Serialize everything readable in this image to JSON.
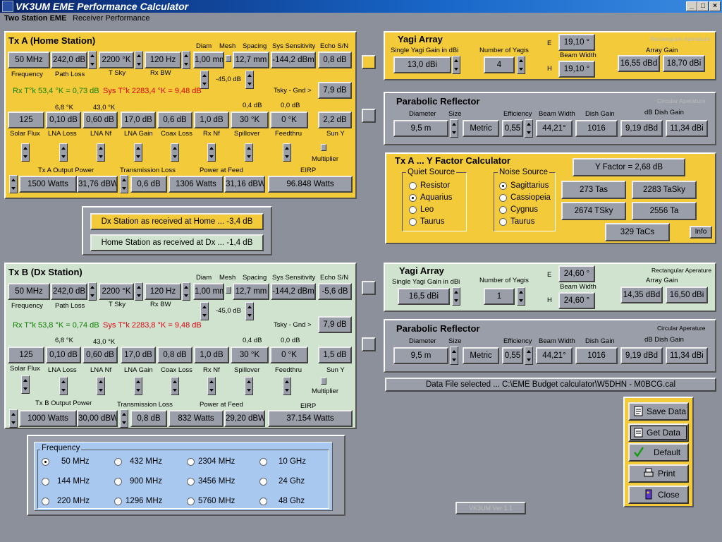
{
  "window": {
    "title": "VK3UM EME Performance Calculator"
  },
  "menu": [
    "Two Station EME",
    "Receiver Performance"
  ],
  "tx_a": {
    "title": "Tx A (Home Station)",
    "hdr": {
      "diam": "Diam",
      "mesh": "Mesh",
      "spacing": "Spacing",
      "sys_sens": "Sys Sensitivity",
      "echo": "Echo S/N"
    },
    "r1": {
      "freq": "50 MHz",
      "path": "242,0 dB",
      "tsky": "2200 °K",
      "rxbw": "120 Hz",
      "diam": "1,00 mm",
      "spacing": "12,7 mm",
      "sens": "-144,2 dBm",
      "echo": "0,8 dB"
    },
    "r1_labels": {
      "freq": "Frequency",
      "path": "Path Loss",
      "tsky": "T Sky",
      "rxbw": "Rx BW",
      "mesh_db": "-45,0 dB"
    },
    "rx_tk": "Rx T°k 53,4 °K = 0,73 dB",
    "sys_tk": "Sys T°k 2283,4 °K = 9,48 dB",
    "tsky_gnd_label": "Tsky - Gnd >",
    "tsky_gnd": "7,9 dB",
    "r2_top": {
      "lna_k": "6,8 °K",
      "lnanf_k": "43,0 °K",
      "spill_db": "0,4 dB",
      "feed_db": "0,0 dB"
    },
    "r2": {
      "solar": "125",
      "lna_loss": "0,10 dB",
      "lna_nf": "0,60 dB",
      "lna_gain": "17,0 dB",
      "coax": "0,6 dB",
      "rxnf": "1,0 dB",
      "spill": "30 °K",
      "feed": "0 °K",
      "suny": "2,2 dB"
    },
    "r2_labels": {
      "solar": "Solar Flux",
      "lna_loss": "LNA Loss",
      "lna_nf": "LNA Nf",
      "lna_gain": "LNA Gain",
      "coax": "Coax Loss",
      "rxnf": "Rx Nf",
      "spill": "Spillover",
      "feed": "Feedthru",
      "suny": "Sun Y",
      "mult": "Multiplier"
    },
    "r3_labels": {
      "out": "Tx A Output Power",
      "tl": "Transmission Loss",
      "paf": "Power at Feed",
      "eirp": "EIRP"
    },
    "r3": {
      "watts": "1500 Watts",
      "dbw": "31,76 dBW",
      "tl": "0,6 dB",
      "paf_w": "1306 Watts",
      "paf_dbw": "31,16 dBW",
      "eirp": "96.848 Watts"
    }
  },
  "received": {
    "dx_home": "Dx Station as received at Home ... -3,4 dB",
    "home_dx": "Home Station as received at Dx ... -1,4 dB"
  },
  "tx_b": {
    "title": "Tx B (Dx Station)",
    "hdr": {
      "diam": "Diam",
      "mesh": "Mesh",
      "spacing": "Spacing",
      "sys_sens": "Sys Sensitivity",
      "echo": "Echo S/N"
    },
    "r1": {
      "freq": "50 MHz",
      "path": "242,0 dB",
      "tsky": "2200 °K",
      "rxbw": "120 Hz",
      "diam": "1,00 mm",
      "spacing": "12,7 mm",
      "sens": "-144,2 dBm",
      "echo": "-5,6 dB"
    },
    "r1_labels": {
      "freq": "Frequency",
      "path": "Path Loss",
      "tsky": "T Sky",
      "rxbw": "Rx BW",
      "mesh_db": "-45,0 dB"
    },
    "rx_tk": "Rx T°k 53,8 °K = 0,74 dB",
    "sys_tk": "Sys T°k 2283,8 °K = 9,48 dB",
    "tsky_gnd_label": "Tsky - Gnd >",
    "tsky_gnd": "7,9 dB",
    "r2_top": {
      "lna_k": "6,8 °K",
      "lnanf_k": "43,0 °K",
      "spill_db": "0,4 dB",
      "feed_db": "0,0 dB"
    },
    "r2": {
      "solar": "125",
      "lna_loss": "0,10 dB",
      "lna_nf": "0,60 dB",
      "lna_gain": "17,0 dB",
      "coax": "0,8 dB",
      "rxnf": "1,0 dB",
      "spill": "30 °K",
      "feed": "0 °K",
      "suny": "1,5 dB"
    },
    "r2_labels": {
      "solar": "Solar Flux",
      "lna_loss": "LNA Loss",
      "lna_nf": "LNA Nf",
      "lna_gain": "LNA Gain",
      "coax": "Coax Loss",
      "rxnf": "Rx Nf",
      "spill": "Spillover",
      "feed": "Feedthru",
      "suny": "Sun Y",
      "mult": "Multiplier"
    },
    "r3_labels": {
      "out": "Tx B Output Power",
      "tl": "Transmission Loss",
      "paf": "Power at Feed",
      "eirp": "EIRP"
    },
    "r3": {
      "watts": "1000 Watts",
      "dbw": "30,00 dBW",
      "tl": "0,8 dB",
      "paf_w": "832 Watts",
      "paf_dbw": "29,20 dBW",
      "eirp": "37.154 Watts"
    }
  },
  "frequency": {
    "title": "Frequency",
    "options": [
      "50 MHz",
      "144 MHz",
      "220 MHz",
      "432 MHz",
      "900 MHz",
      "1296 MHz",
      "2304 MHz",
      "3456 MHz",
      "5760 MHz",
      "10 GHz",
      "24 Ghz",
      "48 Ghz"
    ],
    "selected": "50 MHz"
  },
  "yagi_a": {
    "title": "Yagi Array",
    "single_label": "Single Yagi Gain in dBi",
    "single": "13,0 dBi",
    "num_label": "Number of Yagis",
    "num": "4",
    "e_label": "E",
    "h_label": "H",
    "bw_label": "Beam Width",
    "e": "19,10 °",
    "h": "19,10 °",
    "aperture": "Rectangular Aperature",
    "gain_label": "Array Gain",
    "gain_dbd": "16,55 dBd",
    "gain_dbi": "18,70 dBi"
  },
  "dish_a": {
    "title": "Parabolic Reflector",
    "aperture": "Circular Aperature",
    "diam_label": "Diameter",
    "size_label": "Size",
    "eff_label": "Efficiency",
    "bw_label": "Beam Width",
    "gain_label": "Dish Gain",
    "db_gain_label": "dB Dish Gain",
    "diam": "9,5 m",
    "metric": "Metric",
    "eff": "0,55",
    "bw": "44,21°",
    "gain": "1016",
    "dbd": "9,19 dBd",
    "dbi": "11,34 dBi"
  },
  "yfactor": {
    "title": "Tx A ... Y Factor Calculator",
    "quiet_title": "Quiet Source",
    "quiet": [
      "Resistor",
      "Aquarius",
      "Leo",
      "Taurus"
    ],
    "quiet_selected": "Aquarius",
    "noise_title": "Noise Source",
    "noise": [
      "Sagittarius",
      "Cassiopeia",
      "Cygnus",
      "Taurus"
    ],
    "noise_selected": "Sagittarius",
    "yf": "Y Factor = 2,68 dB",
    "tas": "273 Tas",
    "tasky": "2283 TaSky",
    "tsky": "2674 TSky",
    "ta": "2556 Ta",
    "tacs": "329 TaCs",
    "info": "Info"
  },
  "yagi_b": {
    "title": "Yagi Array",
    "single_label": "Single Yagi Gain in dBi",
    "single": "16,5 dBi",
    "num_label": "Number of Yagis",
    "num": "1",
    "e_label": "E",
    "h_label": "H",
    "bw_label": "Beam Width",
    "e": "24,60 °",
    "h": "24,60 °",
    "aperture": "Rectangular Aperature",
    "gain_label": "Array Gain",
    "gain_dbd": "14,35 dBd",
    "gain_dbi": "16,50 dBi"
  },
  "dish_b": {
    "title": "Parabolic Reflector",
    "aperture": "Circular Aperature",
    "diam_label": "Diameter",
    "size_label": "Size",
    "eff_label": "Efficiency",
    "bw_label": "Beam Width",
    "gain_label": "Dish Gain",
    "db_gain_label": "dB Dish Gain",
    "diam": "9,5 m",
    "metric": "Metric",
    "eff": "0,55",
    "bw": "44,21°",
    "gain": "1016",
    "dbd": "9,19 dBd",
    "dbi": "11,34 dBi"
  },
  "datafile": "Data File selected ... C:\\EME Budget calculator\\W5DHN - M0BCG.cal",
  "buttons": {
    "save": "Save Data",
    "get": "Get Data",
    "default": "Default",
    "print": "Print",
    "close": "Close"
  },
  "version": "VK3UM Ver 1.1"
}
